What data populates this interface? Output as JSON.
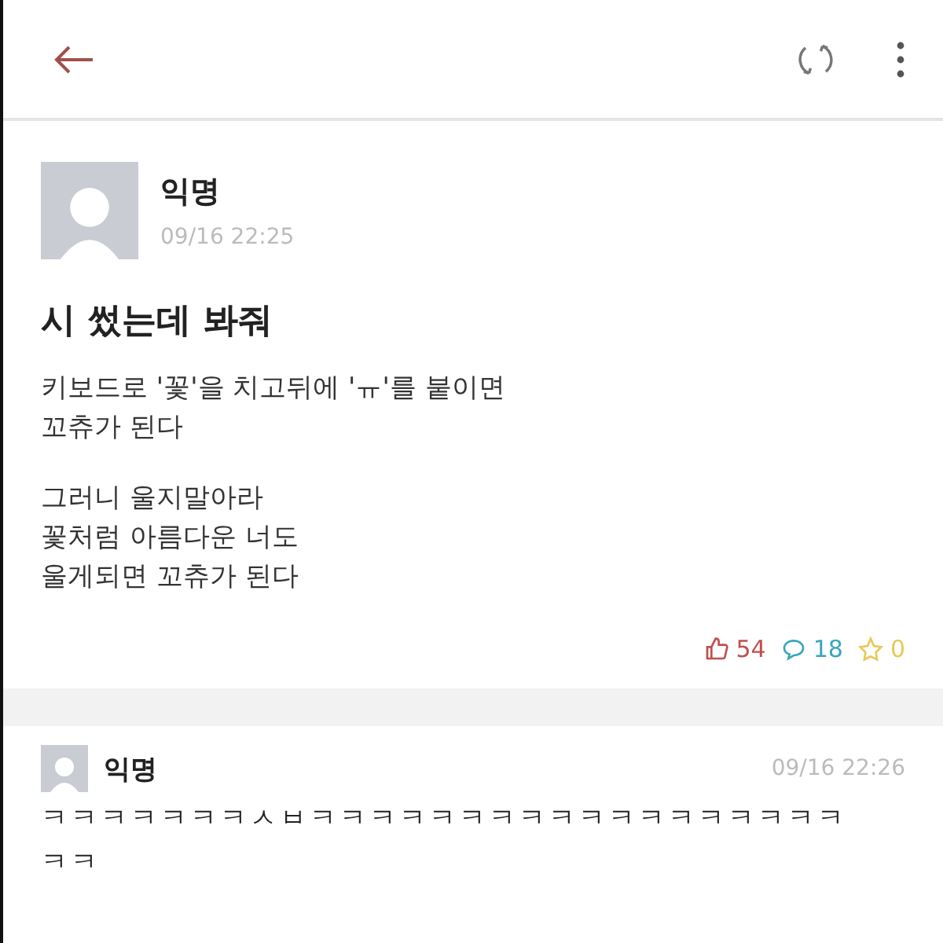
{
  "post": {
    "author": "익명",
    "time": "09/16 22:25",
    "title": "시 썼는데 봐줘",
    "paragraphs": [
      [
        "키보드로 '꽃'을 치고뒤에 'ㅠ'를 붙이면",
        "꼬츄가 된다"
      ],
      [
        "그러니 울지말아라",
        "꽃처럼 아름다운 너도",
        "울게되면 꼬츄가 된다"
      ]
    ],
    "stats": [
      {
        "kind": "like",
        "count": "54",
        "color": "#c0504d"
      },
      {
        "kind": "comment",
        "count": "18",
        "color": "#3aa6b9"
      },
      {
        "kind": "scrap",
        "count": "0",
        "color": "#e8c95a"
      }
    ]
  },
  "comments": [
    {
      "author": "익명",
      "time": "09/16 22:26",
      "lines": [
        "ㅋㅋㅋㅋㅋㅋㅋㅅㅂㅋㅋㅋㅋㅋㅋㅋㅋㅋㅋㅋㅋㅋㅋㅋㅋㅋㅋ",
        "ㅋㅋ"
      ]
    }
  ]
}
